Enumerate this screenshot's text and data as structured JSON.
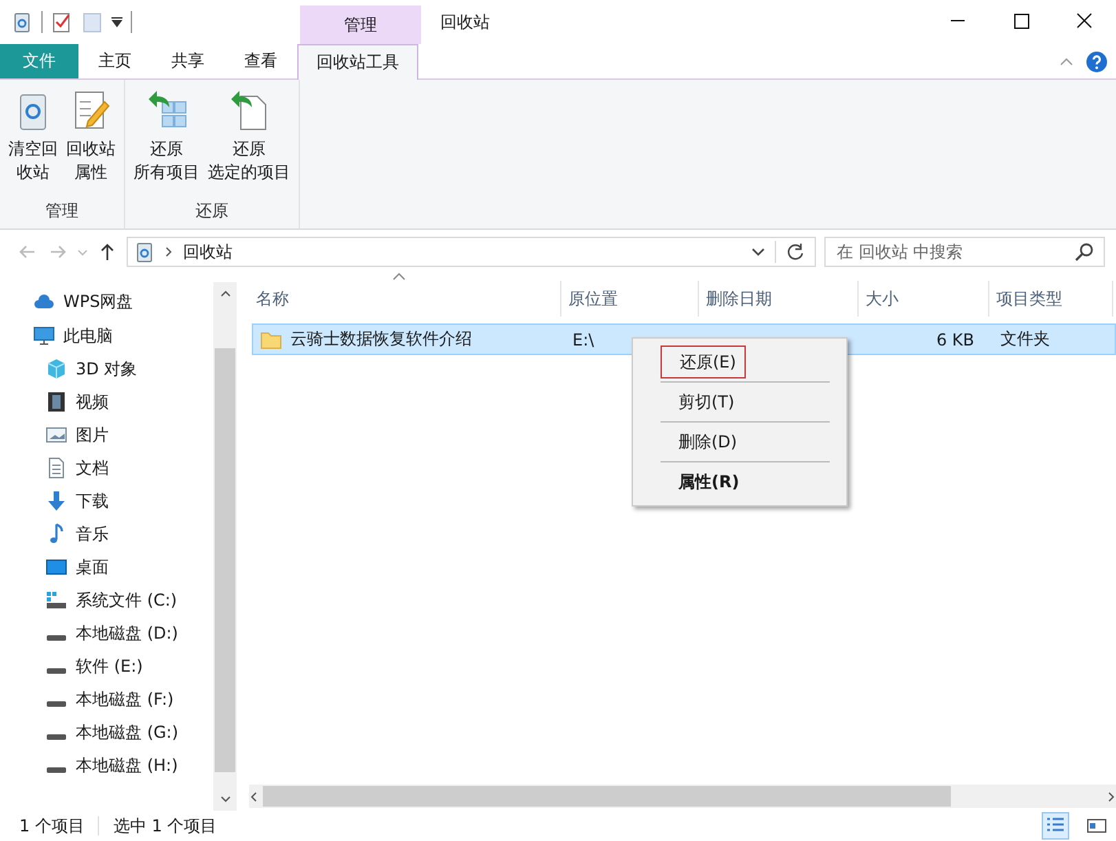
{
  "window": {
    "title": "回收站",
    "context_tab_group": "管理"
  },
  "tabs": [
    {
      "label": "文件",
      "kind": "file",
      "selected": false
    },
    {
      "label": "主页",
      "kind": "tab",
      "selected": false
    },
    {
      "label": "共享",
      "kind": "tab",
      "selected": false
    },
    {
      "label": "查看",
      "kind": "tab",
      "selected": false
    },
    {
      "label": "回收站工具",
      "kind": "tab",
      "selected": true
    }
  ],
  "ribbon_groups": [
    {
      "label": "管理",
      "buttons": [
        {
          "kind": "empty-bin",
          "lines": [
            "清空回",
            "收站"
          ]
        },
        {
          "kind": "properties",
          "lines": [
            "回收站",
            "属性"
          ]
        }
      ]
    },
    {
      "label": "还原",
      "buttons": [
        {
          "kind": "restore-all",
          "lines": [
            "还原",
            "所有项目"
          ]
        },
        {
          "kind": "restore-selected",
          "lines": [
            "还原",
            "选定的项目"
          ]
        }
      ]
    }
  ],
  "address": {
    "path": "回收站",
    "search_placeholder": "在 回收站 中搜索"
  },
  "sidebar": {
    "items": [
      {
        "label": "WPS网盘",
        "kind": "cloud"
      },
      {
        "label": "此电脑",
        "kind": "pc",
        "children": [
          {
            "label": "3D 对象",
            "kind": "cube"
          },
          {
            "label": "视频",
            "kind": "film"
          },
          {
            "label": "图片",
            "kind": "image"
          },
          {
            "label": "文档",
            "kind": "doc"
          },
          {
            "label": "下载",
            "kind": "download"
          },
          {
            "label": "音乐",
            "kind": "music"
          },
          {
            "label": "桌面",
            "kind": "desktop"
          },
          {
            "label": "系统文件 (C:)",
            "kind": "sysdrive"
          },
          {
            "label": "本地磁盘 (D:)",
            "kind": "drive"
          },
          {
            "label": "软件 (E:)",
            "kind": "drive"
          },
          {
            "label": "本地磁盘 (F:)",
            "kind": "drive"
          },
          {
            "label": "本地磁盘 (G:)",
            "kind": "drive"
          },
          {
            "label": "本地磁盘 (H:)",
            "kind": "drive"
          }
        ]
      }
    ]
  },
  "table": {
    "columns": [
      "名称",
      "原位置",
      "删除日期",
      "大小",
      "项目类型"
    ],
    "rows": [
      {
        "name": "云骑士数据恢复软件介绍",
        "location": "E:\\",
        "size": "6 KB",
        "type": "文件夹",
        "selected": true
      }
    ]
  },
  "context_menu": [
    {
      "label": "还原(E)",
      "bold": false,
      "outlined": true
    },
    {
      "label": "剪切(T)",
      "bold": false,
      "outlined": false
    },
    {
      "label": "删除(D)",
      "bold": false,
      "outlined": false
    },
    {
      "label": "属性(R)",
      "bold": true,
      "outlined": false
    }
  ],
  "status_bar": {
    "count": "1 个项目",
    "selection": "选中 1 个项目",
    "views": [
      {
        "kind": "details",
        "selected": true
      },
      {
        "kind": "large",
        "selected": false
      }
    ]
  }
}
